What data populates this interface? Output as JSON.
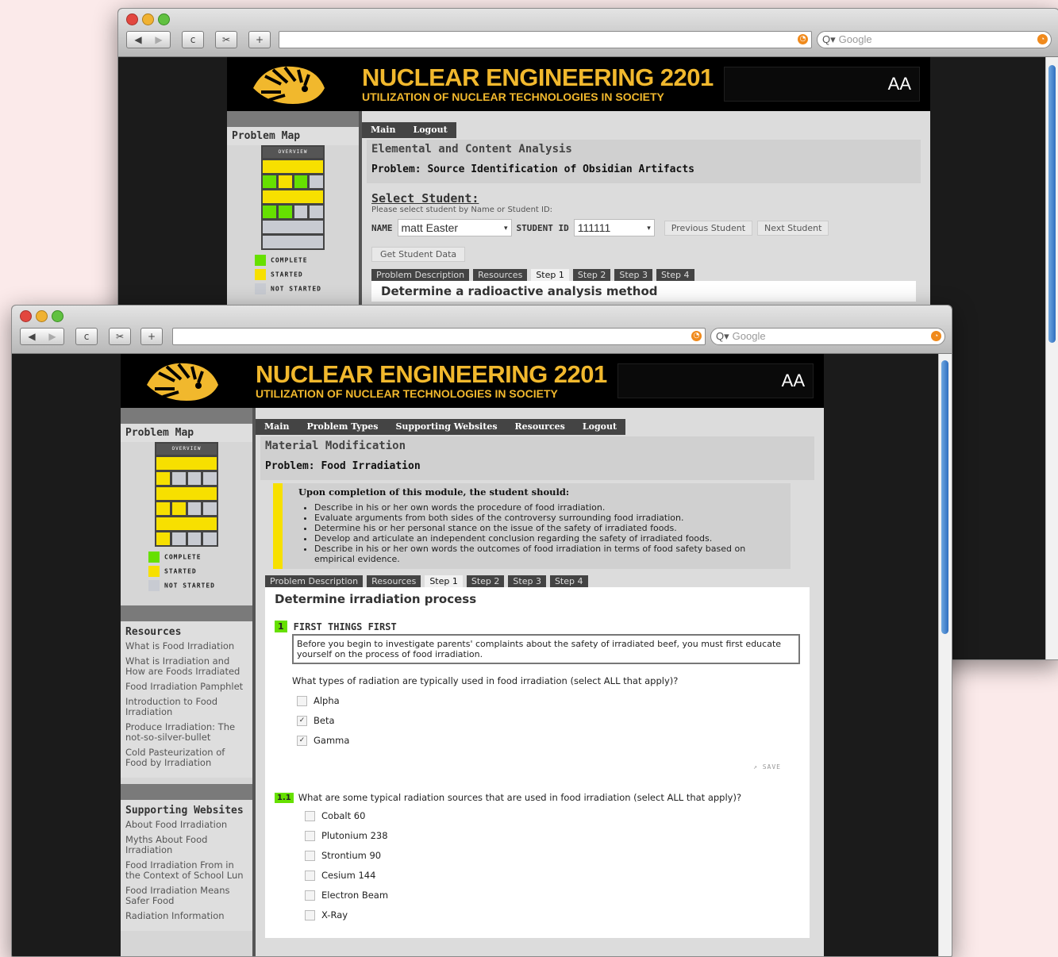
{
  "browser": {
    "search_placeholder": "Google",
    "back_icon": "◀",
    "forward_icon": "▶",
    "reload_icon": "c",
    "plus_icon": "+"
  },
  "site": {
    "title": "NUCLEAR ENGINEERING 2201",
    "subtitle": "UTILIZATION OF NUCLEAR TECHNOLOGIES IN SOCIETY",
    "aa": "AA",
    "colors": {
      "gold": "#f1b82d",
      "complete": "#66e000",
      "started": "#f7e000",
      "not_started": "#c8cbd2"
    }
  },
  "problem_map": {
    "title": "Problem Map",
    "overview": "OVERVIEW",
    "legend": {
      "complete": "COMPLETE",
      "started": "STARTED",
      "not_started": "NOT STARTED"
    }
  },
  "back_window": {
    "nav": [
      "Main",
      "Logout"
    ],
    "module": "Elemental and Content Analysis",
    "problem": "Problem: Source Identification of Obsidian Artifacts",
    "select_student": "Select Student:",
    "select_help": "Please select student by Name or Student ID:",
    "name_label": "NAME",
    "name_value": "matt Easter",
    "id_label": "STUDENT ID",
    "id_value": "111111",
    "prev": "Previous Student",
    "next": "Next Student",
    "get_data": "Get Student Data",
    "tabs": [
      "Problem Description",
      "Resources",
      "Step 1",
      "Step 2",
      "Step 3",
      "Step 4"
    ],
    "step_title": "Determine a radioactive analysis method",
    "map_rows": [
      [
        "Y",
        "Y",
        "Y",
        "Y"
      ],
      [
        "G",
        "Y",
        "G",
        "N"
      ],
      [
        "Y",
        "Y",
        "Y",
        "Y"
      ],
      [
        "G",
        "G",
        "N",
        "N"
      ],
      [
        "N",
        "N",
        "N",
        "N"
      ],
      [
        "N",
        "N",
        "N",
        "N"
      ]
    ]
  },
  "front_window": {
    "nav": [
      "Main",
      "Problem Types",
      "Supporting Websites",
      "Resources",
      "Logout"
    ],
    "module": "Material Modification",
    "problem": "Problem: Food Irradiation",
    "objectives_heading": "Upon completion of this module, the student should:",
    "objectives": [
      "Describe in his or her own words the procedure of food irradiation.",
      "Evaluate arguments from both sides of the controversy surrounding food irradiation.",
      "Determine his or her personal stance on the issue of the safety of irradiated foods.",
      "Develop and articulate an independent conclusion regarding the safety of irradiated foods.",
      "Describe in his or her own words the outcomes of food irradiation in terms of food safety based on empirical evidence."
    ],
    "tabs": [
      "Problem Description",
      "Resources",
      "Step 1",
      "Step 2",
      "Step 3",
      "Step 4"
    ],
    "step_title": "Determine irradiation process",
    "task1": {
      "num": "1",
      "title": "FIRST THINGS FIRST",
      "text": "Before you begin to investigate parents' complaints about the safety of irradiated beef, you must first educate yourself on the process of food irradiation.",
      "question": "What types of radiation are typically used in food irradiation (select ALL that apply)?",
      "options": [
        {
          "label": "Alpha",
          "mark": ""
        },
        {
          "label": "Beta",
          "mark": "✓"
        },
        {
          "label": "Gamma",
          "mark": "✓"
        }
      ],
      "save": "SAVE"
    },
    "task2": {
      "num": "1.1",
      "question": "What are some typical radiation sources that are used in food irradiation (select ALL that apply)?",
      "options": [
        "Cobalt 60",
        "Plutonium 238",
        "Strontium 90",
        "Cesium 144",
        "Electron Beam",
        "X-Ray"
      ]
    },
    "resources": {
      "title": "Resources",
      "links": [
        "What is Food Irradiation",
        "What is Irradiation and How are Foods Irradiated",
        "Food Irradiation Pamphlet",
        "Introduction to Food Irradiation",
        "Produce Irradiation: The not-so-silver-bullet",
        "Cold Pasteurization of Food by Irradiation"
      ]
    },
    "websites": {
      "title": "Supporting Websites",
      "links": [
        "About Food Irradiation",
        "Myths About Food Irradiation",
        "Food Irradiation From in the Context of School Lun",
        "Food Irradiation Means Safer Food",
        "Radiation Information"
      ]
    },
    "map_rows": [
      [
        "Y",
        "Y",
        "Y",
        "Y"
      ],
      [
        "Y",
        "N",
        "N",
        "N"
      ],
      [
        "Y",
        "Y",
        "Y",
        "Y"
      ],
      [
        "Y",
        "Y",
        "N",
        "N"
      ],
      [
        "Y",
        "Y",
        "Y",
        "Y"
      ],
      [
        "Y",
        "N",
        "N",
        "N"
      ]
    ]
  }
}
